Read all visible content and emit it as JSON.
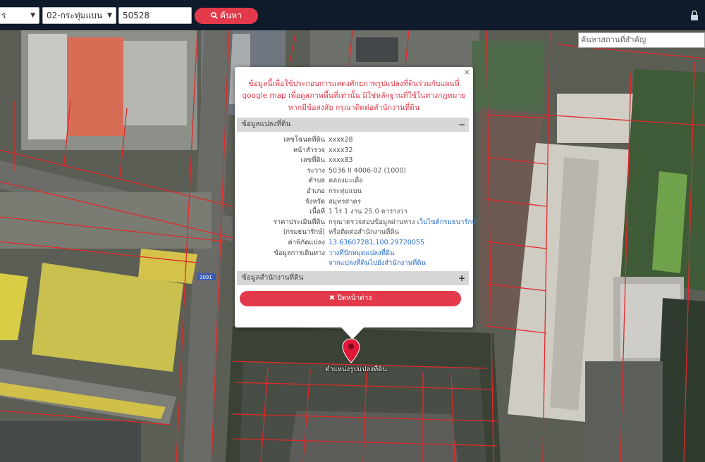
{
  "toolbar": {
    "province": "ร",
    "district": "02-กระทุ่มแบน",
    "parcel_number": "50528",
    "search_label": "ค้นหา"
  },
  "map": {
    "place_search_placeholder": "ค้นหาสถานที่สำคัญ",
    "marker_label": "ตำแหน่งรูปแปลงที่ดิน",
    "road_number": "3091"
  },
  "popup": {
    "close_symbol": "×",
    "note": "ข้อมูลนี้เพื่อใช้ประกอบการแสดงศักยภาพรูปแปลงที่ดินร่วมกับแผนที่ google map เพื่อดูสภาพพื้นที่เท่านั้น มิใช่หลักฐานที่ใช้ในทางกฎหมาย หากมีข้อสงสัย กรุณาติดต่อสำนักงานที่ดิน",
    "section1": {
      "title": "ข้อมูลแปลงที่ดิน",
      "sign": "−"
    },
    "rows": [
      {
        "label": "เลขโฉนดที่ดิน",
        "value": "xxxx28"
      },
      {
        "label": "หน้าสำรวจ",
        "value": "xxxx32"
      },
      {
        "label": "เลขที่ดิน",
        "value": "xxxx83"
      },
      {
        "label": "ระวาง",
        "value": "5036 II 4006-02 (1000)"
      },
      {
        "label": "ตำบล",
        "value": "คลองมะเดื่อ"
      },
      {
        "label": "อำเภอ",
        "value": "กระทุ่มแบน"
      },
      {
        "label": "จังหวัด",
        "value": "สมุทรสาคร"
      },
      {
        "label": "เนื้อที่",
        "value": "1 ไร่ 1 งาน 25.0 ตารางวา"
      },
      {
        "label": "ราคาประเมินที่ดิน",
        "value": "กรุณาตรวจสอบข้อมูลผ่านทาง",
        "link": "เว็บไซต์กรมธนารักษ์"
      },
      {
        "label": "(กรมธนารักษ์)",
        "value": "หรือติดต่อสำนักงานที่ดิน"
      },
      {
        "label": "ค่าพิกัดแปลง",
        "value": "",
        "link": "13.63607281,100.29720055"
      },
      {
        "label": "ข้อมูลการเดินทาง",
        "value": "",
        "link": "วางที่ปักหมุดแปลงที่ดิน"
      },
      {
        "label": "",
        "value": "",
        "link": "จากแปลงที่ดินไปยังสำนักงานที่ดิน"
      }
    ],
    "section2": {
      "title": "ข้อมูลสำนักงานที่ดิน",
      "sign": "+"
    },
    "close_window_label": "ปิดหน้าต่าง"
  },
  "colors": {
    "accent": "#e33a4b",
    "topbar": "#0f1a2b",
    "link": "#2a6fd1",
    "parcel_line": "#e02a2a"
  },
  "icons": [
    "search-icon",
    "lock-icon",
    "close-icon",
    "map-marker-icon"
  ]
}
